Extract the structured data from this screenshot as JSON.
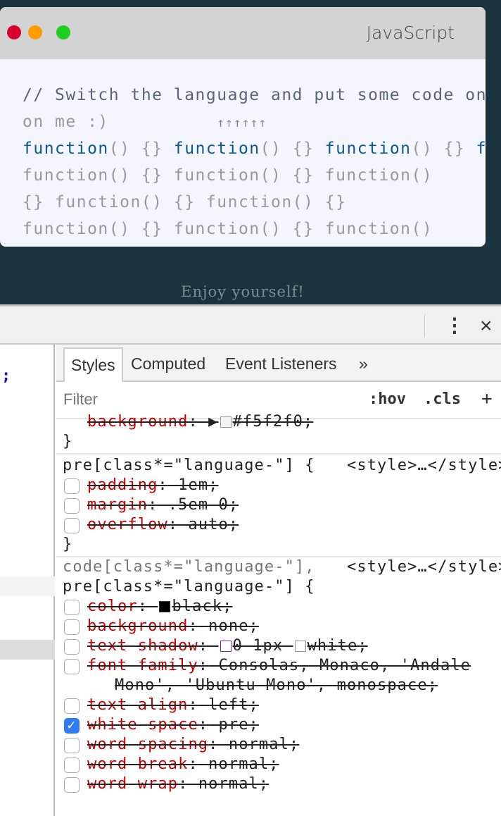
{
  "window": {
    "title": "JavaScript",
    "colors": {
      "close": "#d8002c",
      "minimize": "#ff9a00",
      "maximize": "#1ecf1e"
    },
    "code_lines": {
      "comment": "// Switch the language and put some code on",
      "line2": "on me :)",
      "arrows": "↑↑↑↑↑↑",
      "line3_kw": "function",
      "line3_rest": "() {} ",
      "line3_tail": "f",
      "line4": "function() {} function() {} function()",
      "line5": "{} function() {} function() {}",
      "line6": "function() {} function() {} function()"
    }
  },
  "footer_text": "Enjoy yourself!",
  "devtools": {
    "more_icon": "vertical-ellipsis",
    "close_icon": "×",
    "left_panel_text": ";",
    "tabs": [
      "Styles",
      "Computed",
      "Event Listeners",
      "»"
    ],
    "filter_placeholder": "Filter",
    "hov": ":hov",
    "cls": ".cls",
    "add": "+",
    "rule0": {
      "prop": "background",
      "value": "#f5f2f0;",
      "close": "}"
    },
    "rule1": {
      "selector": "pre[class*=\"language-\"] {",
      "source": "<style>…</style>",
      "props": [
        {
          "name": "padding",
          "value": " 1em;",
          "checked": false
        },
        {
          "name": "margin",
          "value": " .5em 0;",
          "checked": false
        },
        {
          "name": "overflow",
          "value": " auto;",
          "checked": false
        }
      ],
      "close": "}"
    },
    "rule2": {
      "selector1": "code[class*=\"language-\"],",
      "selector2": "pre[class*=\"language-\"] {",
      "source": "<style>…</style>",
      "props": [
        {
          "name": "color",
          "value": "black;",
          "checked": false
        },
        {
          "name": "background",
          "value": " none;",
          "checked": false
        },
        {
          "name": "text-shadow",
          "value1": "0 1px ",
          "value2": "white;",
          "checked": false
        },
        {
          "name": "font-family",
          "value": " Consolas, Monaco, 'Andale",
          "value_cont": "Mono', 'Ubuntu Mono', monospace;",
          "checked": false
        },
        {
          "name": "text-align",
          "value": " left;",
          "checked": false
        },
        {
          "name": "white-space",
          "value": " pre;",
          "checked": true
        },
        {
          "name": "word-spacing",
          "value": " normal;",
          "checked": false
        },
        {
          "name": "word-break",
          "value": " normal;",
          "checked": false
        },
        {
          "name": "word-wrap",
          "value": " normal;",
          "checked": false
        }
      ]
    }
  }
}
